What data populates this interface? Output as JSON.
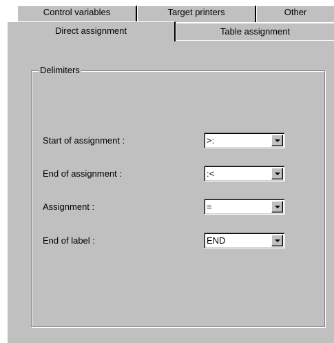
{
  "tabs": {
    "back_row": [
      "Control variables",
      "Target printers",
      "Other"
    ],
    "front_row": [
      "Direct assignment",
      "Table assignment"
    ],
    "selected": "Direct assignment"
  },
  "group": {
    "title": "Delimiters"
  },
  "fields": [
    {
      "label": "Start of assignment :",
      "value": ">:"
    },
    {
      "label": "End of assignment :",
      "value": ":<"
    },
    {
      "label": "Assignment :",
      "value": "="
    },
    {
      "label": "End of label :",
      "value": "END"
    }
  ],
  "icons": {
    "dropdown": "chevron-down-icon"
  },
  "colors": {
    "face": "#c0c0c0",
    "highlight": "#ffffff",
    "shadow": "#808080",
    "dark": "#000000"
  }
}
